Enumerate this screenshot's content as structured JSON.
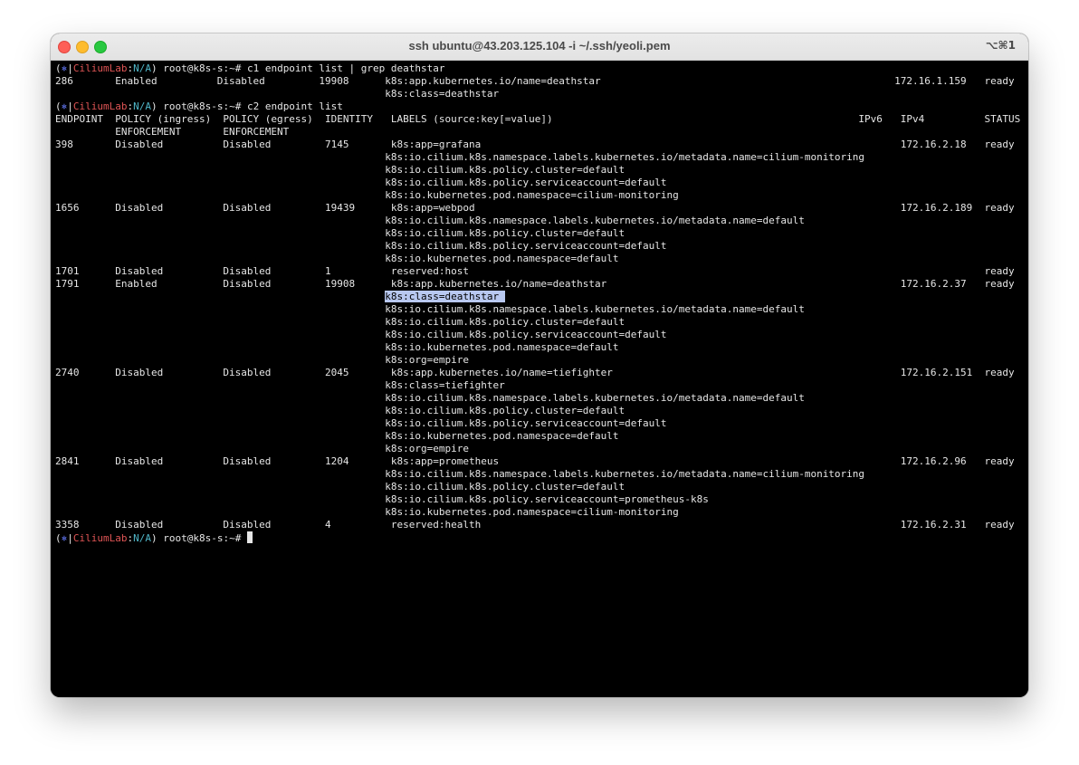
{
  "window": {
    "title": "ssh ubuntu@43.203.125.104 -i ~/.ssh/yeoli.pem",
    "shortcut": "⌥⌘1"
  },
  "prompt": {
    "open": "(",
    "symbol": "⎈",
    "sep": "|",
    "context": "CiliumLab",
    "colon": ":",
    "namespace": "N/A",
    "close": ")",
    "user": " root@k8s-s:~# "
  },
  "commands": {
    "c1": "c1 endpoint list | grep deathstar",
    "c2": "c2 endpoint list"
  },
  "c1_output": [
    "286       Enabled          Disabled         19908      k8s:app.kubernetes.io/name=deathstar                                                 172.16.1.159   ready",
    "                                                       k8s:class=deathstar"
  ],
  "table_header": [
    "ENDPOINT  POLICY (ingress)  POLICY (egress)  IDENTITY   LABELS (source:key[=value])                                                   IPv6   IPv4          STATUS",
    "          ENFORCEMENT       ENFORCEMENT"
  ],
  "rows_before_highlight": [
    "398       Disabled          Disabled         7145       k8s:app=grafana                                                                      172.16.2.18   ready",
    "                                                       k8s:io.cilium.k8s.namespace.labels.kubernetes.io/metadata.name=cilium-monitoring",
    "                                                       k8s:io.cilium.k8s.policy.cluster=default",
    "                                                       k8s:io.cilium.k8s.policy.serviceaccount=default",
    "                                                       k8s:io.kubernetes.pod.namespace=cilium-monitoring",
    "1656      Disabled          Disabled         19439      k8s:app=webpod                                                                       172.16.2.189  ready",
    "                                                       k8s:io.cilium.k8s.namespace.labels.kubernetes.io/metadata.name=default",
    "                                                       k8s:io.cilium.k8s.policy.cluster=default",
    "                                                       k8s:io.cilium.k8s.policy.serviceaccount=default",
    "                                                       k8s:io.kubernetes.pod.namespace=default",
    "1701      Disabled          Disabled         1          reserved:host                                                                                      ready",
    "1791      Enabled           Disabled         19908      k8s:app.kubernetes.io/name=deathstar                                                 172.16.2.37   ready"
  ],
  "highlight_indent": "                                                       ",
  "highlight_text": "k8s:class=deathstar ",
  "rows_after_highlight": [
    "                                                       k8s:io.cilium.k8s.namespace.labels.kubernetes.io/metadata.name=default",
    "                                                       k8s:io.cilium.k8s.policy.cluster=default",
    "                                                       k8s:io.cilium.k8s.policy.serviceaccount=default",
    "                                                       k8s:io.kubernetes.pod.namespace=default",
    "                                                       k8s:org=empire",
    "2740      Disabled          Disabled         2045       k8s:app.kubernetes.io/name=tiefighter                                                172.16.2.151  ready",
    "                                                       k8s:class=tiefighter",
    "                                                       k8s:io.cilium.k8s.namespace.labels.kubernetes.io/metadata.name=default",
    "                                                       k8s:io.cilium.k8s.policy.cluster=default",
    "                                                       k8s:io.cilium.k8s.policy.serviceaccount=default",
    "                                                       k8s:io.kubernetes.pod.namespace=default",
    "                                                       k8s:org=empire",
    "2841      Disabled          Disabled         1204       k8s:app=prometheus                                                                   172.16.2.96   ready",
    "                                                       k8s:io.cilium.k8s.namespace.labels.kubernetes.io/metadata.name=cilium-monitoring",
    "                                                       k8s:io.cilium.k8s.policy.cluster=default",
    "                                                       k8s:io.cilium.k8s.policy.serviceaccount=prometheus-k8s",
    "                                                       k8s:io.kubernetes.pod.namespace=cilium-monitoring",
    "3358      Disabled          Disabled         4          reserved:health                                                                      172.16.2.31   ready"
  ],
  "colors": {
    "terminal_bg": "#000000",
    "text": "#e6e6e6",
    "context": "#e05555",
    "namespace": "#4fb6c8",
    "symbol": "#5b6ee1",
    "selection": "#b8c8f0"
  }
}
